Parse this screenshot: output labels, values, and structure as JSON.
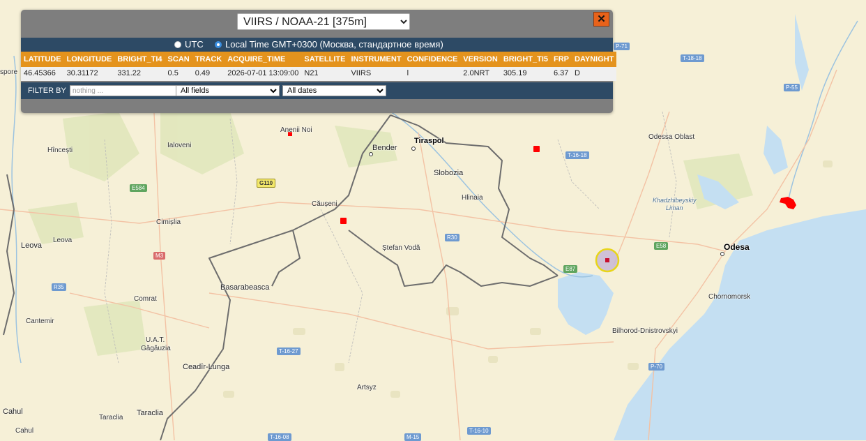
{
  "panel": {
    "sensor_options": [
      "VIIRS / NOAA-21 [375m]"
    ],
    "sensor_selected": "VIIRS / NOAA-21 [375m]",
    "close_symbol": "✕",
    "time_options": [
      {
        "label": "UTC",
        "selected": false
      },
      {
        "label": "Local Time GMT+0300 (Москва, стандартное время)",
        "selected": true
      }
    ],
    "table": {
      "headers": [
        "LATITUDE",
        "LONGITUDE",
        "BRIGHT_TI4",
        "SCAN",
        "TRACK",
        "ACQUIRE_TIME",
        "SATELLITE",
        "INSTRUMENT",
        "CONFIDENCE",
        "VERSION",
        "BRIGHT_TI5",
        "FRP",
        "DAYNIGHT"
      ],
      "rows": [
        [
          "46.45366",
          "30.31172",
          "331.22",
          "0.5",
          "0.49",
          "2026-07-01 13:09:00",
          "N21",
          "VIIRS",
          "l",
          "2.0NRT",
          "305.19",
          "6.37",
          "D"
        ]
      ]
    },
    "filter": {
      "label": "FILTER BY",
      "placeholder": "nothing ...",
      "field_selected": "All fields",
      "date_selected": "All dates"
    }
  },
  "map": {
    "places": {
      "anenii_noi": "Anenii Noi",
      "bender": "Bender",
      "tiraspol": "Tiraspol",
      "slobozia": "Slobozia",
      "hlinaia": "Hlinaia",
      "causeni": "Căușeni",
      "stefan_voda": "Ștefan Vodă",
      "hincesti": "Hîncești",
      "ialoveni": "Ialoveni",
      "cimislia": "Cimișlia",
      "leova": "Leova",
      "leova2": "Leova",
      "basarabeasca": "Basarabeasca",
      "comrat": "Comrat",
      "cantemir": "Cantemir",
      "uat": "U.A.T.",
      "gagauzia": "Găgăuzia",
      "ceadir_lunga": "Ceadîr-Lunga",
      "taraclia": "Taraclia",
      "taraclia2": "Taraclia",
      "cahul": "Cahul",
      "cahul2": "Cahul",
      "artsyz": "Artsyz",
      "bilhorod": "Bilhorod-Dnistrovskyi",
      "chornomorsk": "Chornomorsk",
      "odesa": "Odesa",
      "odesa_oblast": "Odessa Oblast",
      "lake_line1": "Khadzhibeyskiy",
      "lake_line2": "Liman",
      "spore": "spore"
    },
    "roads": {
      "p71": "P-71",
      "t1618a": "T-18-18",
      "t1618b": "T-16-18",
      "p55": "P-55",
      "e584": "E584",
      "g110": "G110",
      "r30": "R30",
      "m3": "M3",
      "r35": "R35",
      "e58": "E58",
      "e87": "E87",
      "t1627": "T-16-27",
      "p70": "P-70",
      "t1608": "T-16-08",
      "m15": "M-15",
      "t1610": "T-16-10"
    },
    "colors": {
      "land": "#f6f0d7",
      "water": "#c4dff2",
      "border": "#6d6d6d",
      "fire": "#ff0000",
      "highlight": "#e8d51a"
    }
  }
}
